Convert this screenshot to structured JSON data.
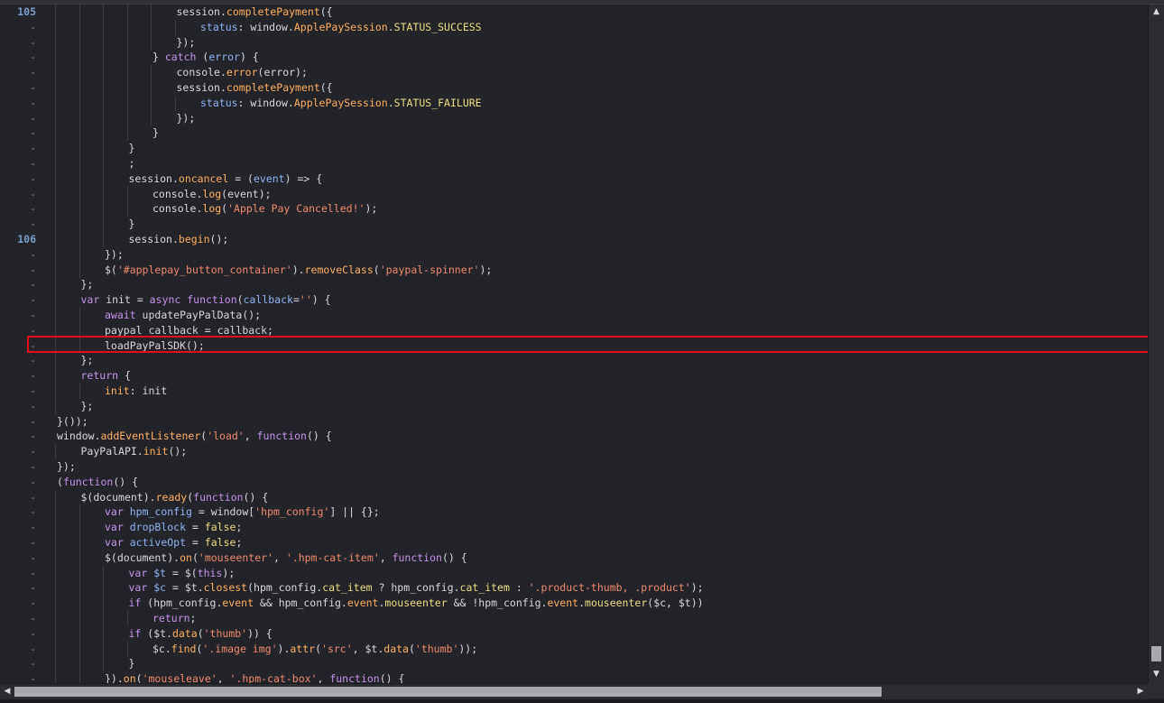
{
  "editor": {
    "lines": [
      {
        "g": "105",
        "i": 5,
        "t": [
          [
            "session."
          ],
          [
            "completePayment",
            "f"
          ],
          [
            "({"
          ]
        ]
      },
      {
        "g": "-",
        "i": 6,
        "t": [
          [
            "status",
            "p"
          ],
          [
            ": window."
          ],
          [
            "ApplePaySession",
            "f"
          ],
          [
            "."
          ],
          [
            "STATUS_SUCCESS",
            "c"
          ]
        ]
      },
      {
        "g": "-",
        "i": 5,
        "t": [
          [
            "});"
          ]
        ]
      },
      {
        "g": "-",
        "i": 4,
        "t": [
          [
            "} "
          ],
          [
            "catch",
            "k"
          ],
          [
            " ("
          ],
          [
            "error",
            "p"
          ],
          [
            ") {"
          ]
        ]
      },
      {
        "g": "-",
        "i": 5,
        "t": [
          [
            "console."
          ],
          [
            "error",
            "f"
          ],
          [
            "(error);"
          ]
        ]
      },
      {
        "g": "-",
        "i": 5,
        "t": [
          [
            "session."
          ],
          [
            "completePayment",
            "f"
          ],
          [
            "({"
          ]
        ]
      },
      {
        "g": "-",
        "i": 6,
        "t": [
          [
            "status",
            "p"
          ],
          [
            ": window."
          ],
          [
            "ApplePaySession",
            "f"
          ],
          [
            "."
          ],
          [
            "STATUS_FAILURE",
            "c"
          ]
        ]
      },
      {
        "g": "-",
        "i": 5,
        "t": [
          [
            "});"
          ]
        ]
      },
      {
        "g": "-",
        "i": 4,
        "t": [
          [
            "}"
          ]
        ]
      },
      {
        "g": "-",
        "i": 3,
        "t": [
          [
            "}"
          ]
        ]
      },
      {
        "g": "-",
        "i": 3,
        "t": [
          [
            ";"
          ]
        ]
      },
      {
        "g": "-",
        "i": 3,
        "t": [
          [
            "session."
          ],
          [
            "oncancel",
            "f"
          ],
          [
            " = ("
          ],
          [
            "event",
            "p"
          ],
          [
            ") => {"
          ]
        ]
      },
      {
        "g": "-",
        "i": 4,
        "t": [
          [
            "console."
          ],
          [
            "log",
            "f"
          ],
          [
            "(event);"
          ]
        ]
      },
      {
        "g": "-",
        "i": 4,
        "t": [
          [
            "console."
          ],
          [
            "log",
            "f"
          ],
          [
            "("
          ],
          [
            "'Apple Pay Cancelled!'",
            "s"
          ],
          [
            ");"
          ]
        ]
      },
      {
        "g": "-",
        "i": 3,
        "t": [
          [
            "}"
          ]
        ]
      },
      {
        "g": "106",
        "i": 3,
        "t": [
          [
            "session."
          ],
          [
            "begin",
            "f"
          ],
          [
            "();"
          ]
        ]
      },
      {
        "g": "-",
        "i": 2,
        "t": [
          [
            "});"
          ]
        ]
      },
      {
        "g": "-",
        "i": 2,
        "t": [
          [
            "$("
          ],
          [
            "'#applepay_button_container'",
            "s"
          ],
          [
            ")."
          ],
          [
            "removeClass",
            "f"
          ],
          [
            "("
          ],
          [
            "'paypal-spinner'",
            "s"
          ],
          [
            ");"
          ]
        ]
      },
      {
        "g": "-",
        "i": 1,
        "t": [
          [
            "};"
          ]
        ]
      },
      {
        "g": "-",
        "i": 1,
        "t": [
          [
            "var",
            "k"
          ],
          [
            " init = "
          ],
          [
            "async",
            "k"
          ],
          [
            " "
          ],
          [
            "function",
            "k"
          ],
          [
            "("
          ],
          [
            "callback",
            "p"
          ],
          [
            "="
          ],
          [
            "''",
            "s"
          ],
          [
            ") {"
          ]
        ]
      },
      {
        "g": "-",
        "i": 2,
        "t": [
          [
            "await",
            "k"
          ],
          [
            " updatePayPalData();"
          ]
        ]
      },
      {
        "g": "-",
        "i": 2,
        "t": [
          [
            "paypal_callback = callback;"
          ]
        ]
      },
      {
        "g": "-",
        "i": 2,
        "t": [
          [
            "loadPayPalSDK();"
          ]
        ]
      },
      {
        "g": "-",
        "i": 1,
        "t": [
          [
            "};"
          ]
        ]
      },
      {
        "g": "-",
        "i": 1,
        "t": [
          [
            "return",
            "k"
          ],
          [
            " {"
          ]
        ]
      },
      {
        "g": "-",
        "i": 2,
        "t": [
          [
            "init",
            "f"
          ],
          [
            ": init"
          ]
        ]
      },
      {
        "g": "-",
        "i": 1,
        "t": [
          [
            "};"
          ]
        ]
      },
      {
        "g": "-",
        "i": 0,
        "t": [
          [
            "}());"
          ]
        ]
      },
      {
        "g": "-",
        "i": 0,
        "t": [
          [
            "window."
          ],
          [
            "addEventListener",
            "f"
          ],
          [
            "("
          ],
          [
            "'load'",
            "s"
          ],
          [
            ", "
          ],
          [
            "function",
            "k"
          ],
          [
            "() {"
          ]
        ]
      },
      {
        "g": "-",
        "i": 1,
        "t": [
          [
            "PayPalAPI."
          ],
          [
            "init",
            "f"
          ],
          [
            "();"
          ]
        ]
      },
      {
        "g": "-",
        "i": 0,
        "t": [
          [
            "});"
          ]
        ]
      },
      {
        "g": "-",
        "i": 0,
        "t": [
          [
            "("
          ],
          [
            "function",
            "k"
          ],
          [
            "() {"
          ]
        ]
      },
      {
        "g": "-",
        "i": 1,
        "t": [
          [
            "$(document)."
          ],
          [
            "ready",
            "f"
          ],
          [
            "("
          ],
          [
            "function",
            "k"
          ],
          [
            "() {"
          ]
        ]
      },
      {
        "g": "-",
        "i": 2,
        "t": [
          [
            "var",
            "k"
          ],
          [
            " "
          ],
          [
            "hpm_config",
            "p"
          ],
          [
            " = window["
          ],
          [
            "'hpm_config'",
            "s"
          ],
          [
            "] || {};"
          ]
        ]
      },
      {
        "g": "-",
        "i": 2,
        "t": [
          [
            "var",
            "k"
          ],
          [
            " "
          ],
          [
            "dropBlock",
            "p"
          ],
          [
            " = "
          ],
          [
            "false",
            "c"
          ],
          [
            ";"
          ]
        ]
      },
      {
        "g": "-",
        "i": 2,
        "t": [
          [
            "var",
            "k"
          ],
          [
            " "
          ],
          [
            "activeOpt",
            "p"
          ],
          [
            " = "
          ],
          [
            "false",
            "c"
          ],
          [
            ";"
          ]
        ]
      },
      {
        "g": "-",
        "i": 2,
        "t": [
          [
            "$(document)."
          ],
          [
            "on",
            "f"
          ],
          [
            "("
          ],
          [
            "'mouseenter'",
            "s"
          ],
          [
            ", "
          ],
          [
            "'.hpm-cat-item'",
            "s"
          ],
          [
            ", "
          ],
          [
            "function",
            "k"
          ],
          [
            "() {"
          ]
        ]
      },
      {
        "g": "-",
        "i": 3,
        "t": [
          [
            "var",
            "k"
          ],
          [
            " "
          ],
          [
            "$t",
            "p"
          ],
          [
            " = $("
          ],
          [
            "this",
            "k"
          ],
          [
            ");"
          ]
        ]
      },
      {
        "g": "-",
        "i": 3,
        "t": [
          [
            "var",
            "k"
          ],
          [
            " "
          ],
          [
            "$c",
            "p"
          ],
          [
            " = $t."
          ],
          [
            "closest",
            "f"
          ],
          [
            "(hpm_config."
          ],
          [
            "cat_item",
            "c"
          ],
          [
            " ? hpm_config."
          ],
          [
            "cat_item",
            "c"
          ],
          [
            " : "
          ],
          [
            "'.product-thumb, .product'",
            "s"
          ],
          [
            ");"
          ]
        ]
      },
      {
        "g": "-",
        "i": 3,
        "t": [
          [
            "if",
            "k"
          ],
          [
            " (hpm_config."
          ],
          [
            "event",
            "f"
          ],
          [
            " && hpm_config."
          ],
          [
            "event",
            "f"
          ],
          [
            "."
          ],
          [
            "mouseenter",
            "c"
          ],
          [
            " && !hpm_config."
          ],
          [
            "event",
            "f"
          ],
          [
            "."
          ],
          [
            "mouseenter",
            "c"
          ],
          [
            "($c, $t))"
          ]
        ]
      },
      {
        "g": "-",
        "i": 4,
        "t": [
          [
            "return",
            "k"
          ],
          [
            ";"
          ]
        ]
      },
      {
        "g": "-",
        "i": 3,
        "t": [
          [
            "if",
            "k"
          ],
          [
            " ($t."
          ],
          [
            "data",
            "f"
          ],
          [
            "("
          ],
          [
            "'thumb'",
            "s"
          ],
          [
            ")) {"
          ]
        ]
      },
      {
        "g": "-",
        "i": 4,
        "t": [
          [
            "$c."
          ],
          [
            "find",
            "f"
          ],
          [
            "("
          ],
          [
            "'.image img'",
            "s"
          ],
          [
            ")."
          ],
          [
            "attr",
            "f"
          ],
          [
            "("
          ],
          [
            "'src'",
            "s"
          ],
          [
            ", $t."
          ],
          [
            "data",
            "f"
          ],
          [
            "("
          ],
          [
            "'thumb'",
            "s"
          ],
          [
            "));"
          ]
        ]
      },
      {
        "g": "-",
        "i": 3,
        "t": [
          [
            "}"
          ]
        ]
      },
      {
        "g": "-",
        "i": 2,
        "t": [
          [
            "})."
          ],
          [
            "on",
            "f"
          ],
          [
            "("
          ],
          [
            "'mouseleave'",
            "s"
          ],
          [
            ", "
          ],
          [
            "'.hpm-cat-box'",
            "s"
          ],
          [
            ", "
          ],
          [
            "function",
            "k"
          ],
          [
            "() {"
          ]
        ]
      }
    ]
  },
  "highlight": {
    "color": "#e20e17",
    "line_index": 22
  },
  "scrollbars": {
    "up_arrow": "▲",
    "down_arrow": "▼",
    "left_arrow": "◀",
    "right_arrow": "▶",
    "vertical_position": 0.96,
    "horizontal_thumb_fraction": 0.76
  },
  "colors": {
    "background": "#232429",
    "keyword": "#c792ea",
    "function": "#ffb062",
    "string": "#ef8a6d",
    "param": "#8fb4f2",
    "constant": "#eedc82"
  }
}
